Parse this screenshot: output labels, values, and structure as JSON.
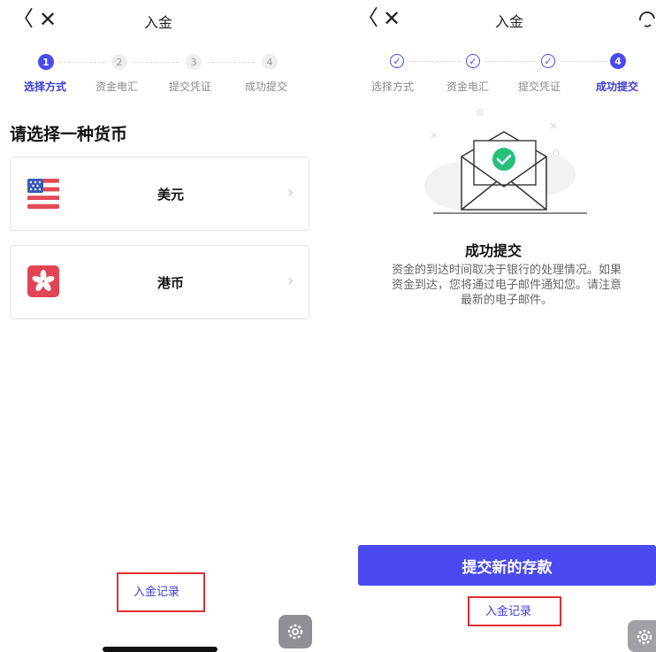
{
  "left": {
    "nav": {
      "back": "〈",
      "close": "✕",
      "title": "入金"
    },
    "steps": [
      {
        "num": "1",
        "label": "选择方式"
      },
      {
        "num": "2",
        "label": "资金电汇"
      },
      {
        "num": "3",
        "label": "提交凭证"
      },
      {
        "num": "4",
        "label": "成功提交"
      }
    ],
    "heading": "请选择一种货币",
    "currencies": [
      {
        "label": "美元",
        "icon": "us-flag-icon"
      },
      {
        "label": "港币",
        "icon": "hk-flag-icon"
      }
    ],
    "record_link": "入金记录"
  },
  "right": {
    "nav": {
      "back": "〈",
      "close": "✕",
      "title": "入金"
    },
    "steps": [
      {
        "label": "选择方式"
      },
      {
        "label": "资金电汇"
      },
      {
        "label": "提交凭证"
      },
      {
        "num": "4",
        "label": "成功提交"
      }
    ],
    "success_title": "成功提交",
    "success_desc_lines": [
      "资金的到达时间取决于银行的处理情况。如果",
      "资金到达，您将通过电子邮件通知您。请注意",
      "最新的电子邮件。"
    ],
    "submit_button": "提交新的存款",
    "record_link": "入金记录"
  },
  "colors": {
    "accent": "#4a4af0",
    "highlight_box": "#e03030"
  }
}
